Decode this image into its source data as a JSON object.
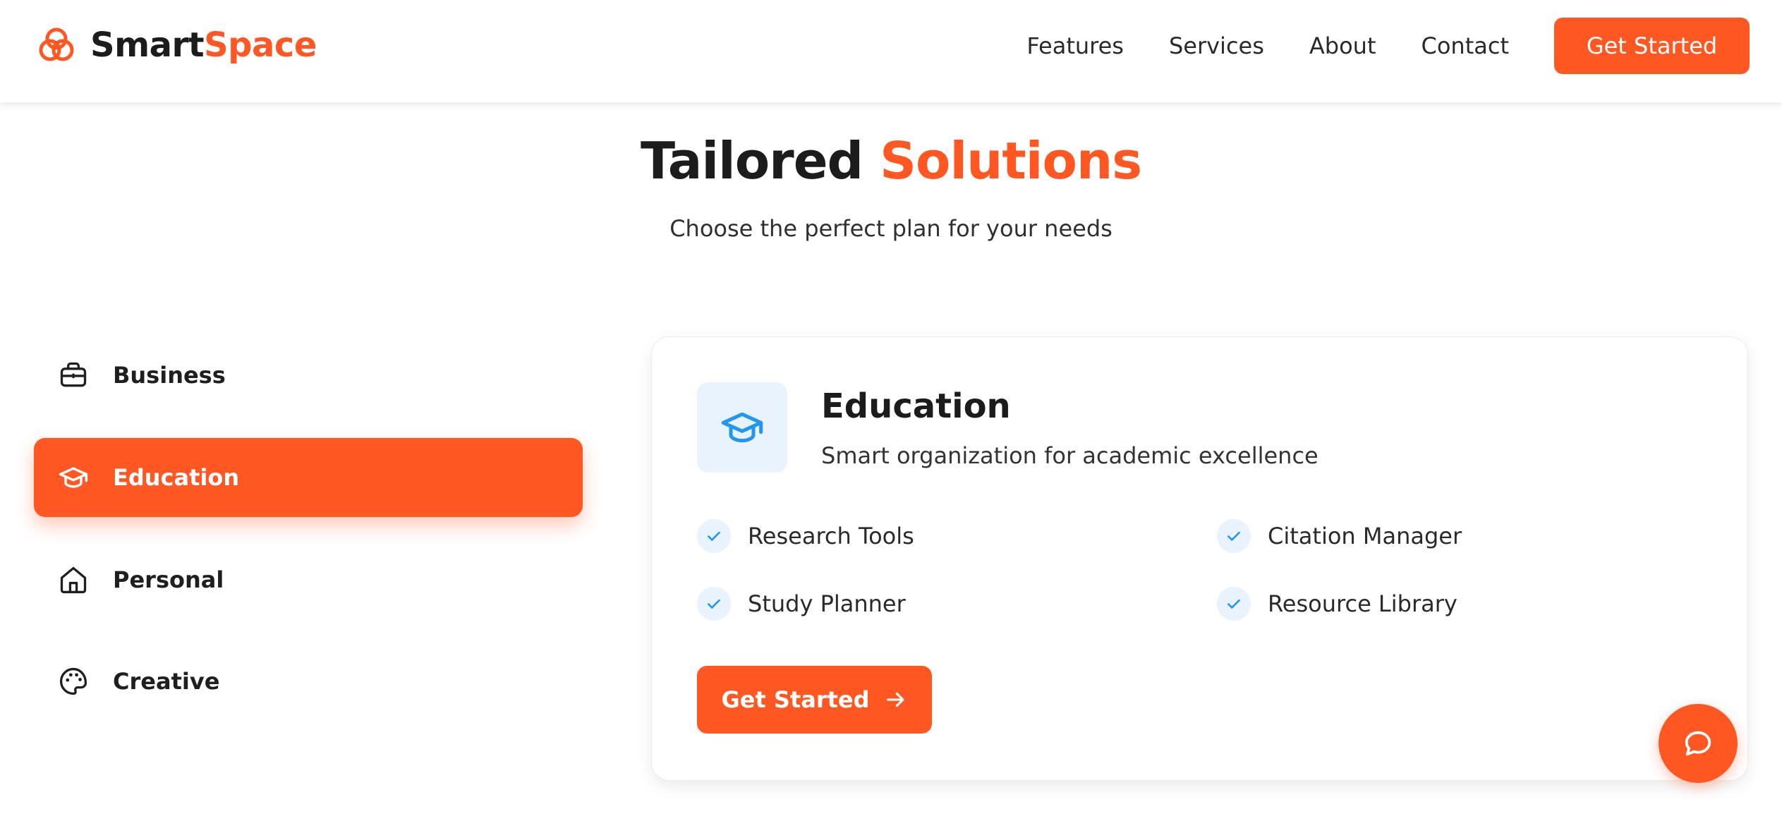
{
  "brand": {
    "name_part1": "Smart",
    "name_part2": "Space",
    "logo_icon": "interlocking-rings-icon"
  },
  "nav": {
    "links": [
      "Features",
      "Services",
      "About",
      "Contact"
    ],
    "cta_label": "Get Started"
  },
  "section": {
    "title_part1": "Tailored ",
    "title_part2": "Solutions",
    "subtitle": "Choose the perfect plan for your needs"
  },
  "tabs": [
    {
      "label": "Business",
      "icon": "briefcase-icon",
      "active": false
    },
    {
      "label": "Education",
      "icon": "graduation-cap-icon",
      "active": true
    },
    {
      "label": "Personal",
      "icon": "home-icon",
      "active": false
    },
    {
      "label": "Creative",
      "icon": "palette-icon",
      "active": false
    }
  ],
  "card": {
    "icon": "graduation-cap-icon",
    "title": "Education",
    "description": "Smart organization for academic excellence",
    "features": [
      "Research Tools",
      "Citation Manager",
      "Study Planner",
      "Resource Library"
    ],
    "cta_label": "Get Started",
    "cta_icon": "arrow-right-icon"
  },
  "chat_button": {
    "icon": "chat-bubble-icon"
  },
  "colors": {
    "accent": "#ff5722",
    "icon_blue": "#2196f3",
    "icon_bg": "#e8f3fd",
    "text_dark": "#1c1c1c"
  }
}
